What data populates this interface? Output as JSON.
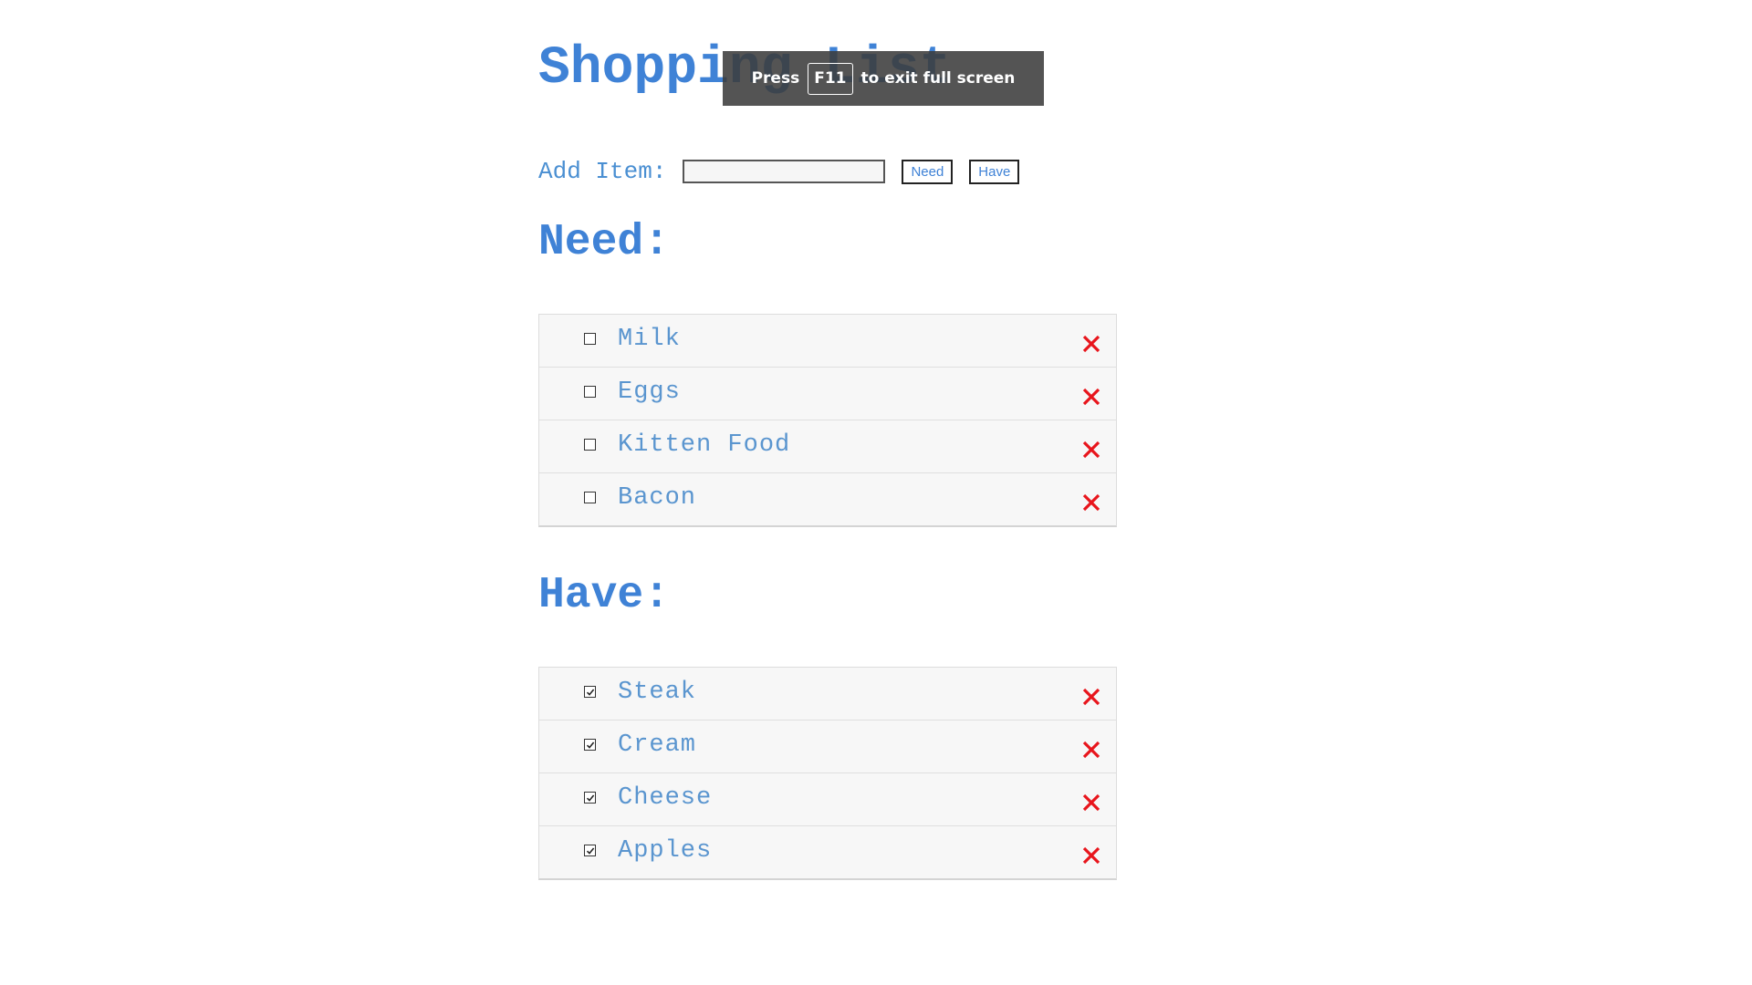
{
  "app": {
    "title": "Shopping List"
  },
  "add_form": {
    "label": "Add Item:",
    "input_value": "",
    "need_button": "Need",
    "have_button": "Have"
  },
  "need": {
    "heading": "Need:",
    "items": [
      {
        "label": "Milk",
        "checked": false
      },
      {
        "label": "Eggs",
        "checked": false
      },
      {
        "label": "Kitten Food",
        "checked": false
      },
      {
        "label": "Bacon",
        "checked": false
      }
    ]
  },
  "have": {
    "heading": "Have:",
    "items": [
      {
        "label": "Steak",
        "checked": true
      },
      {
        "label": "Cream",
        "checked": true
      },
      {
        "label": "Cheese",
        "checked": true
      },
      {
        "label": "Apples",
        "checked": true
      }
    ]
  },
  "fullscreen_notice": {
    "before": "Press",
    "key": "F11",
    "after": "to exit full screen"
  },
  "colors": {
    "accent": "#3f82d6",
    "item_text": "#5a95cf",
    "delete": "#e8151c"
  },
  "icons": {
    "checkbox_unchecked": "checkbox-unchecked-icon",
    "checkbox_checked": "checkbox-checked-icon",
    "delete": "close-icon"
  }
}
